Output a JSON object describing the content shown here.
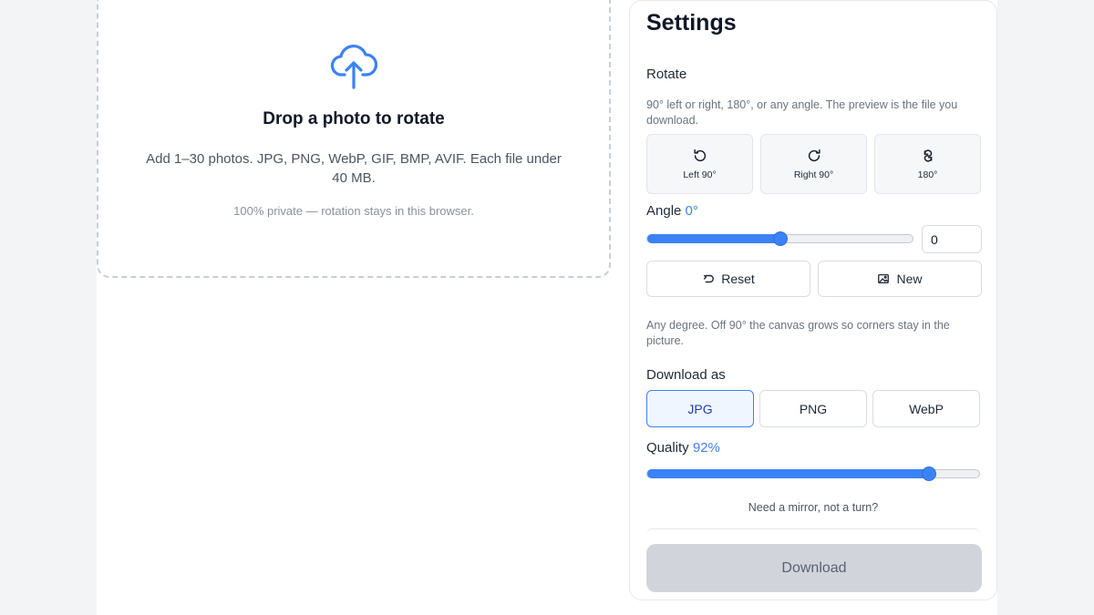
{
  "dropzone": {
    "title": "Drop a photo to rotate",
    "description": "Add 1–30 photos. JPG, PNG, WebP, GIF, BMP, AVIF. Each file under 40 MB.",
    "privacy_note": "100% private — rotation stays in this browser.",
    "icon": "cloud-upload-icon"
  },
  "settings": {
    "title": "Settings",
    "rotate": {
      "label": "Rotate",
      "hint": "90° left or right, 180°, or any angle. The preview is the file you download.",
      "buttons": [
        {
          "label": "Left 90°",
          "icon": "rotate-left-icon"
        },
        {
          "label": "Right 90°",
          "icon": "rotate-right-icon"
        },
        {
          "label": "180°",
          "icon": "rotate-180-icon"
        }
      ]
    },
    "angle": {
      "label": "Angle",
      "value_text": "0°",
      "input_value": "0",
      "slider_fraction": 0.5
    },
    "actions": {
      "reset_label": "Reset",
      "new_label": "New"
    },
    "angle_hint": "Any degree. Off 90° the canvas grows so corners stay in the picture.",
    "download_as": {
      "label": "Download as",
      "formats": [
        "JPG",
        "PNG",
        "WebP"
      ],
      "selected": "JPG"
    },
    "quality": {
      "label": "Quality",
      "value_text": "92%",
      "value": 92
    },
    "mirror_link": "Need a mirror, not a turn?",
    "download_label": "Download"
  },
  "colors": {
    "accent": "#3b82f6",
    "download_disabled": "#d1d5db"
  }
}
